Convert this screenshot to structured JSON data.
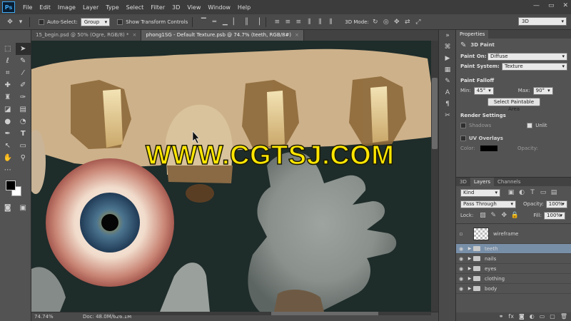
{
  "app": {
    "logo": "Ps"
  },
  "menu": [
    "File",
    "Edit",
    "Image",
    "Layer",
    "Type",
    "Select",
    "Filter",
    "3D",
    "View",
    "Window",
    "Help"
  ],
  "window_controls": {
    "minimize": "—",
    "restore": "▭",
    "close": "✕"
  },
  "options": {
    "auto_select_label": "Auto-Select:",
    "auto_select_value": "Group",
    "show_transform_label": "Show Transform Controls",
    "mode_3d_label": "3D Mode:",
    "workspace": "3D"
  },
  "tabs": [
    {
      "label": "15_begin.psd @ 50% (Ogre, RGB/8) *",
      "close": "×"
    },
    {
      "label": "phong1SG - Default Texture.psb @ 74.7% (teeth, RGB/8#)",
      "close": "×"
    }
  ],
  "watermark": "WWW.CGTSJ.COM",
  "status": {
    "zoom": "74.74%",
    "doc": "Doc: 48.0M/626.1M"
  },
  "properties": {
    "tab": "Properties",
    "title": "3D Paint",
    "paint_on_label": "Paint On:",
    "paint_on_value": "Diffuse",
    "paint_system_label": "Paint System:",
    "paint_system_value": "Texture",
    "falloff_title": "Paint Falloff",
    "min_label": "Min:",
    "min_value": "45°",
    "max_label": "Max:",
    "max_value": "90°",
    "select_area_btn": "Select Paintable Area",
    "render_title": "Render Settings",
    "shadows_label": "Shadows",
    "unlit_label": "Unlit",
    "uv_title": "UV Overlays",
    "color_label": "Color:",
    "opacity_label": "Opacity:"
  },
  "layers_panel": {
    "tabs": [
      "3D",
      "Layers",
      "Channels"
    ],
    "kind": "Kind",
    "blend": "Pass Through",
    "opacity_label": "Opacity:",
    "opacity_value": "100%",
    "lock_label": "Lock:",
    "fill_label": "Fill:",
    "fill_value": "100%",
    "layers": [
      {
        "name": "wireframe",
        "type": "layer"
      },
      {
        "name": "teeth",
        "type": "group",
        "selected": true
      },
      {
        "name": "nails",
        "type": "group"
      },
      {
        "name": "eyes",
        "type": "group"
      },
      {
        "name": "clothing",
        "type": "group"
      },
      {
        "name": "body",
        "type": "group"
      }
    ]
  }
}
